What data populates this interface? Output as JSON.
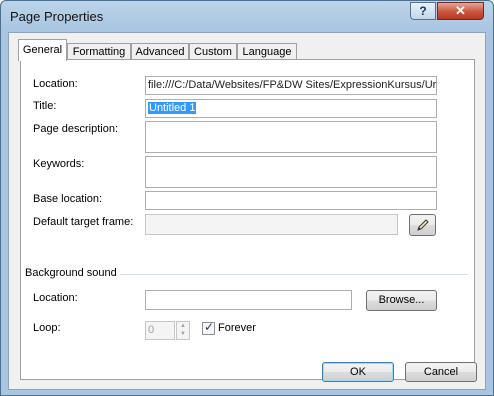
{
  "dialog": {
    "title": "Page Properties",
    "help_glyph": "?",
    "close_glyph": "✕"
  },
  "tabs": [
    {
      "label": "General",
      "active": true
    },
    {
      "label": "Formatting"
    },
    {
      "label": "Advanced"
    },
    {
      "label": "Custom"
    },
    {
      "label": "Language"
    }
  ],
  "general": {
    "location_label": "Location:",
    "location_value": "file:///C:/Data/Websites/FP&DW Sites/ExpressionKursus/Ur",
    "title_label": "Title:",
    "title_value": "Untitled 1",
    "description_label": "Page description:",
    "description_value": "",
    "keywords_label": "Keywords:",
    "keywords_value": "",
    "base_location_label": "Base location:",
    "base_location_value": "",
    "target_frame_label": "Default target frame:",
    "target_frame_value": ""
  },
  "background_sound": {
    "group_label": "Background sound",
    "location_label": "Location:",
    "location_value": "",
    "browse_label": "Browse...",
    "loop_label": "Loop:",
    "loop_value": "0",
    "forever_label": "Forever",
    "forever_checked": true
  },
  "footer": {
    "ok_label": "OK",
    "cancel_label": "Cancel"
  },
  "icons": {
    "edit_frame": "pencil-icon",
    "check": "✓"
  }
}
